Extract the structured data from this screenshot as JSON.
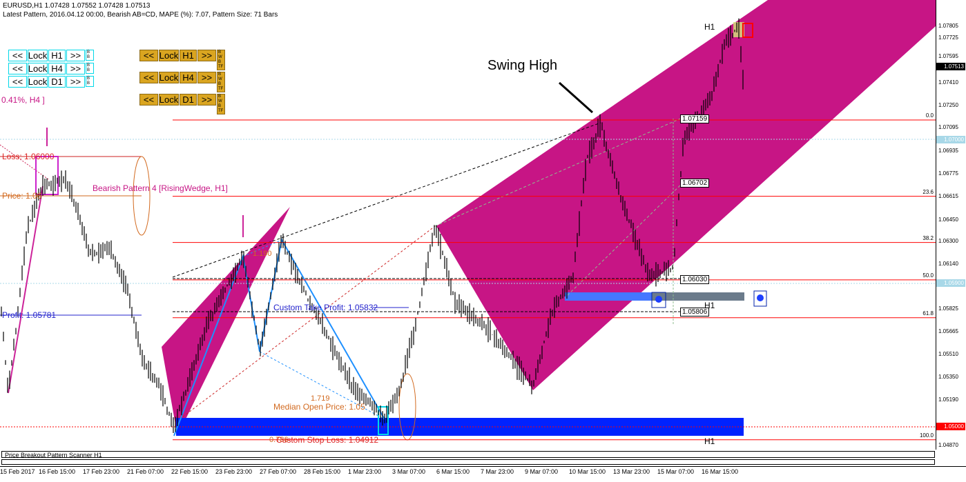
{
  "header": {
    "symbol_line": "EURUSD,H1  1.07428 1.07552 1.07428 1.07513",
    "pattern_line": "Latest Pattern, 2016.04.12 00:00, Bearish AB=CD, MAPE (%): 7.07, Pattern Size: 71 Bars"
  },
  "cyan_panel": {
    "rows": [
      {
        "prev": "<<",
        "lock": "Lock",
        "tf": "H1",
        "next": ">>",
        "mini": "B B"
      },
      {
        "prev": "<<",
        "lock": "Lock",
        "tf": "H4",
        "next": ">>",
        "mini": "B B"
      },
      {
        "prev": "<<",
        "lock": "Lock",
        "tf": "D1",
        "next": ">>",
        "mini": "B B"
      }
    ]
  },
  "gold_panel": {
    "rows": [
      {
        "prev": "<<",
        "lock": "Lock",
        "tf": "H1",
        "next": ">>",
        "mini": "B W B TF"
      },
      {
        "prev": "<<",
        "lock": "Lock",
        "tf": "H4",
        "next": ">>",
        "mini": "B W B TF"
      },
      {
        "prev": "<<",
        "lock": "Lock",
        "tf": "D1",
        "next": ">>",
        "mini": "B W B TF"
      }
    ]
  },
  "annotations": {
    "pct_h4": "0.41%, H4 ]",
    "loss": "Loss: 1.06000",
    "price": "Price: 1.06",
    "profit": "Profit: 1.05781",
    "bearish_pattern": "Bearish Pattern 4  [RisingWedge, H1]",
    "swing_high": "Swing High",
    "ratio_1": "1.190",
    "ratio_2": "1.719",
    "ratio_3": "0.786",
    "custom_tp": "Custom Take Profit: 1.05832",
    "median_open": "Median Open Price: 1.05",
    "custom_sl": "Custom Stop Loss: 1.04912",
    "h1_top": "H1",
    "h1_mid": "H1",
    "h1_bottom": "H1",
    "box_07159": "1.07159",
    "box_06702": "1.06702",
    "box_06030": "1.06030",
    "box_05806": "1.05806"
  },
  "fib_levels": [
    {
      "label": "0.0",
      "price": 1.0715
    },
    {
      "label": "23.6",
      "price": 1.06616
    },
    {
      "label": "38.2",
      "price": 1.06292
    },
    {
      "label": "50.0",
      "price": 1.0603
    },
    {
      "label": "61.8",
      "price": 1.05765
    },
    {
      "label": "100.0",
      "price": 1.0491
    }
  ],
  "price_axis": {
    "ticks": [
      "1.07805",
      "1.07725",
      "1.07595",
      "1.07410",
      "1.07250",
      "1.07095",
      "1.06935",
      "1.06775",
      "1.06615",
      "1.06450",
      "1.06300",
      "1.06140",
      "1.05825",
      "1.05665",
      "1.05510",
      "1.05350",
      "1.05190",
      "1.04870"
    ],
    "current": "1.07513",
    "current_color": "#000000",
    "level_07000": "1.07000",
    "level_07000_color": "#a8d8e8",
    "level_05900": "1.05900",
    "level_05900_color": "#a8d8e8",
    "level_05000": "1.05000",
    "level_05000_color": "#ff0000"
  },
  "time_axis": [
    "15 Feb 2017",
    "16 Feb 15:00",
    "17 Feb 23:00",
    "21 Feb 07:00",
    "22 Feb 15:00",
    "23 Feb 23:00",
    "27 Feb 07:00",
    "28 Feb 15:00",
    "1 Mar 23:00",
    "3 Mar 07:00",
    "6 Mar 15:00",
    "7 Mar 23:00",
    "9 Mar 07:00",
    "10 Mar 15:00",
    "13 Mar 23:00",
    "15 Mar 07:00",
    "16 Mar 15:00"
  ],
  "scanner": {
    "label": "Price Breakout Pattern Scanner H1"
  },
  "colors": {
    "channel": "#c71585",
    "fib_line": "#ff0000",
    "blue_zone": "#0022ff",
    "gold": "#daa520",
    "cyan": "#00d8e8"
  }
}
